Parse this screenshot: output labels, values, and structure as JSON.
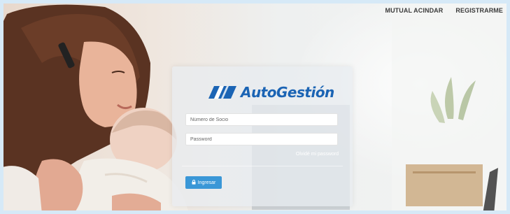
{
  "nav": {
    "mutual": "MUTUAL ACINDAR",
    "register": "REGISTRARME"
  },
  "logo": {
    "text": "AutoGestión",
    "color": "#1b64b4"
  },
  "form": {
    "member_placeholder": "Número de Socio",
    "password_placeholder": "Password",
    "forgot": "Olvidé mi password",
    "submit": "Ingresar",
    "submit_icon": "lock-icon",
    "button_color": "#3a97d7"
  }
}
